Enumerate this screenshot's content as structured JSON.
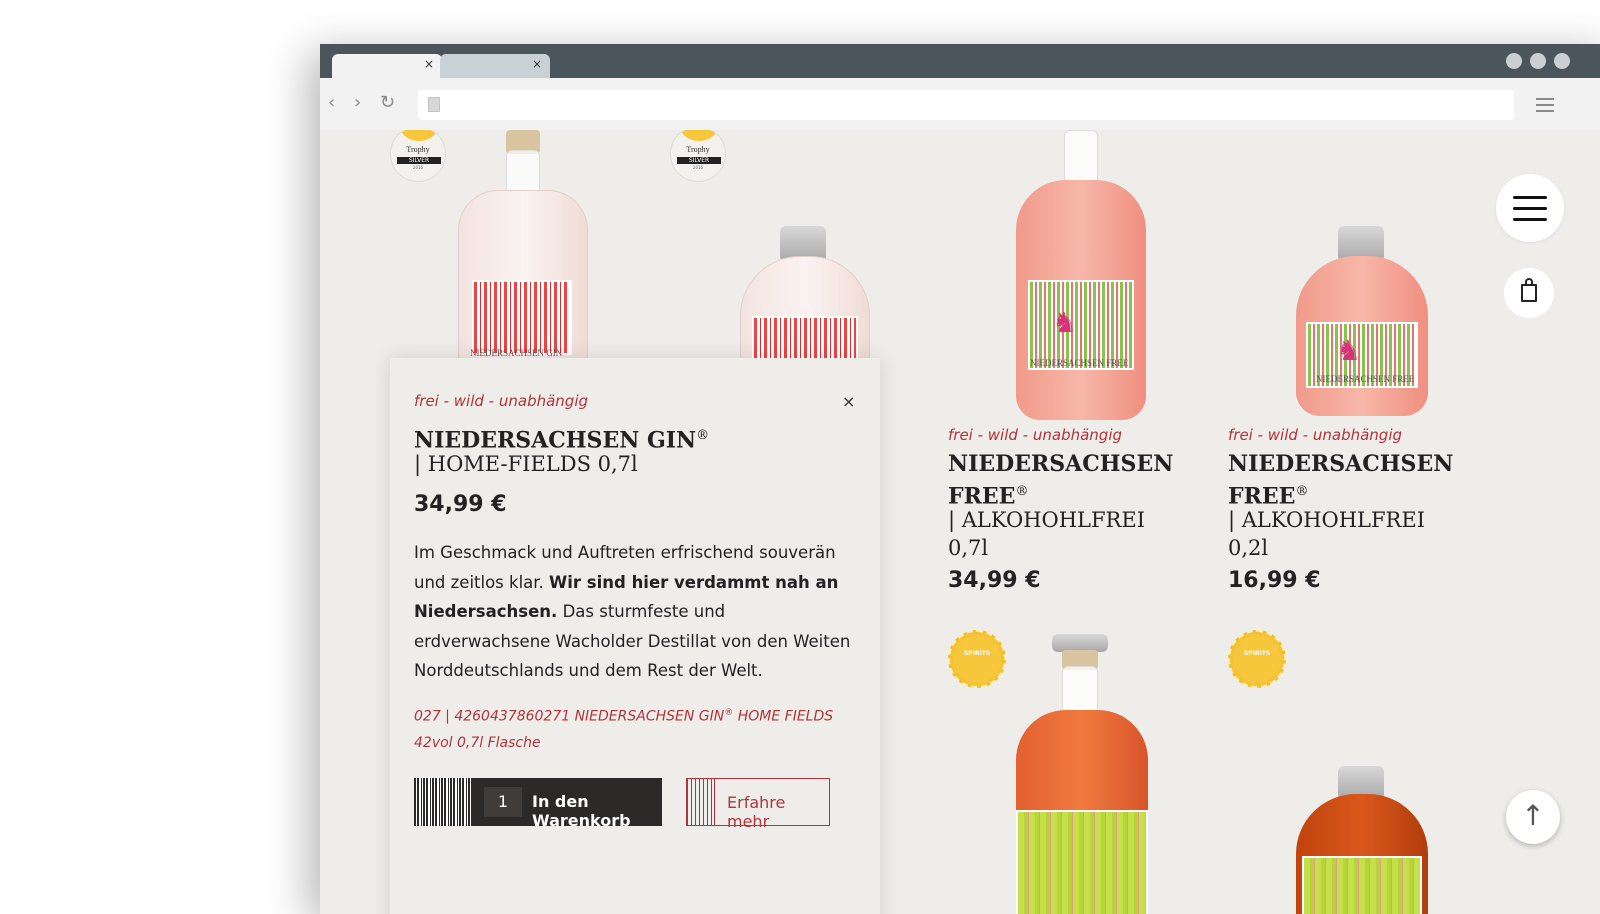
{
  "browser": {
    "tab_close": "×",
    "tab2_close": "×",
    "back": "‹",
    "forward": "›",
    "reload": "↻"
  },
  "site": {
    "accent_color": "#b1343b",
    "to_top": "↑"
  },
  "medals": {
    "trophy": "Trophy",
    "silver": "SILVER",
    "year": "2016",
    "gold_text": "SPIRITS"
  },
  "bottle_labels": {
    "gin": "NIEDERSACHSEN GIN",
    "free": "NIEDERSACHSEN FREE"
  },
  "popup": {
    "close": "×",
    "tagline": "frei - wild - unabhängig",
    "name": "NIEDERSACHSEN GIN",
    "reg": "®",
    "sub": "| HOME-FIELDS 0,7l",
    "price": "34,99 €",
    "desc_1": "Im Geschmack und Auftreten erfrischend souverän und zeitlos klar.",
    "desc_bold": "Wir sind hier verdammt nah an Niedersachsen.",
    "desc_2": "Das sturmfeste und erdverwachsene Wacholder Destillat von den Weiten Norddeutschlands und dem Rest der Welt.",
    "sku_1": "027 | 4260437860271 NIEDERSACHSEN GIN",
    "sku_reg": "®",
    "sku_2": "HOME FIELDS 42vol 0,7l Flasche",
    "qty": "1",
    "cart_label": "In den Warenkorb",
    "more_label": "Erfahre mehr"
  },
  "peek_text": "2l",
  "products": [
    {
      "tagline": "frei - wild - unabhängig",
      "name_line1": "NIEDERSACHSEN",
      "name_line2": "FREE",
      "reg": "®",
      "sub_line1": "| ALKOHOHLFREI",
      "sub_line2": "0,7l",
      "price": "34,99 €"
    },
    {
      "tagline": "frei - wild - unabhängig",
      "name_line1": "NIEDERSACHSEN",
      "name_line2": "FREE",
      "reg": "®",
      "sub_line1": "| ALKOHOHLFREI",
      "sub_line2": "0,2l",
      "price": "16,99 €"
    }
  ]
}
